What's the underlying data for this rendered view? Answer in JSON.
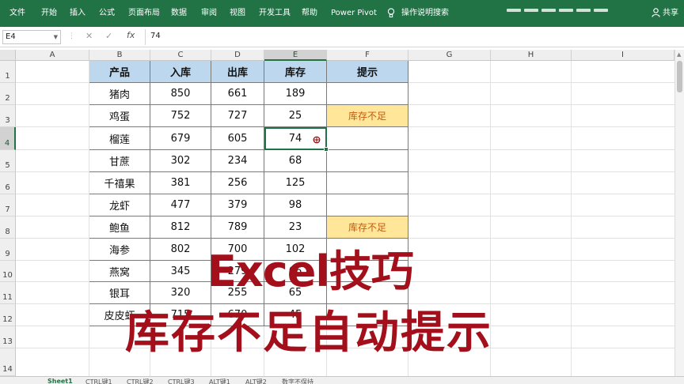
{
  "ribbon": {
    "tabs": [
      "文件",
      "开始",
      "插入",
      "公式",
      "页面布局",
      "数据",
      "审阅",
      "视图",
      "开发工具",
      "帮助",
      "Power Pivot"
    ],
    "tell_me": "操作说明搜索",
    "share": "共享",
    "lightbulb_icon": "lightbulb-icon",
    "person_icon": "person-icon"
  },
  "formula_bar": {
    "name_box": "E4",
    "fx": "fx",
    "cancel": "✕",
    "confirm": "✓",
    "value": "74"
  },
  "columns": [
    "A",
    "B",
    "C",
    "D",
    "E",
    "F",
    "G",
    "H",
    "I"
  ],
  "rows": [
    "1",
    "2",
    "3",
    "4",
    "5",
    "6",
    "7",
    "8",
    "9",
    "10",
    "11",
    "12",
    "13",
    "14"
  ],
  "table": {
    "headers": [
      "产品",
      "入库",
      "出库",
      "库存",
      "提示"
    ],
    "rows": [
      [
        "猪肉",
        "850",
        "661",
        "189",
        ""
      ],
      [
        "鸡蛋",
        "752",
        "727",
        "25",
        "库存不足"
      ],
      [
        "榴莲",
        "679",
        "605",
        "74",
        ""
      ],
      [
        "甘蔗",
        "302",
        "234",
        "68",
        ""
      ],
      [
        "千禧果",
        "381",
        "256",
        "125",
        ""
      ],
      [
        "龙虾",
        "477",
        "379",
        "98",
        ""
      ],
      [
        "鲍鱼",
        "812",
        "789",
        "23",
        "库存不足"
      ],
      [
        "海参",
        "802",
        "700",
        "102",
        ""
      ],
      [
        "燕窝",
        "345",
        "279",
        "66",
        ""
      ],
      [
        "银耳",
        "320",
        "255",
        "65",
        ""
      ],
      [
        "皮皮虾",
        "715",
        "670",
        "45",
        ""
      ]
    ]
  },
  "selection": "E4",
  "caption": {
    "line1": "Excel技巧",
    "line2": "库存不足自动提示"
  },
  "sheet_tabs": [
    "Sheet1",
    "CTRL键1",
    "CTRL键2",
    "CTRL键3",
    "ALT键1",
    "ALT键2",
    "数字不保持"
  ],
  "colors": {
    "ribbon": "#217346",
    "header_fill": "#bdd7ee",
    "warn_fill": "#ffe699",
    "warn_text": "#c55a11",
    "caption": "#a30f1a"
  }
}
